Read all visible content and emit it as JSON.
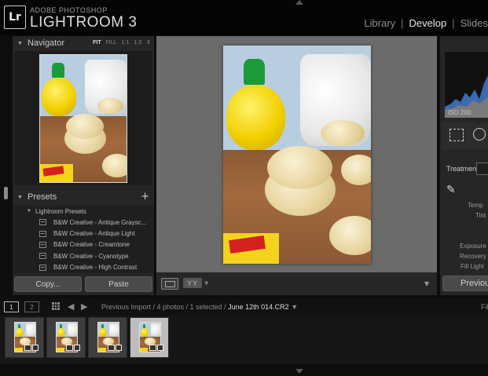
{
  "app": {
    "brand_small": "ADOBE PHOTOSHOP",
    "brand_big": "LIGHTROOM 3",
    "logo": "Lr"
  },
  "modules": [
    {
      "label": "Library",
      "active": false
    },
    {
      "label": "Develop",
      "active": true
    },
    {
      "label": "Slides",
      "active": false
    }
  ],
  "navigator": {
    "title": "Navigator",
    "modes": [
      "FIT",
      "FILL",
      "1:1",
      "1:3"
    ],
    "active_mode": "FIT"
  },
  "presets": {
    "title": "Presets",
    "folder": "Lightroom Presets",
    "items": [
      "B&W Creative - Antique Graysc...",
      "B&W Creative - Antique Light",
      "B&W Creative - Creamtone",
      "B&W Creative - Cyanotype",
      "B&W Creative - High Contrast"
    ]
  },
  "left_buttons": {
    "copy": "Copy...",
    "paste": "Paste"
  },
  "toolbar": {
    "yy_label": "YY"
  },
  "right_panel": {
    "iso": "ISO 200",
    "treatment": "Treatment :",
    "temp": "Temp",
    "tint": "Tint",
    "exposure": "Exposure",
    "recovery": "Recovery",
    "fill_light": "Fill Light",
    "previous": "Previous"
  },
  "filmstrip": {
    "screen1": "1",
    "screen2": "2",
    "source_prefix": "Previous Import / 4 photos / 1 selected /",
    "current_file": "June 12th 014.CR2",
    "filter": "Fil",
    "count": 4,
    "selected_index": 3
  }
}
